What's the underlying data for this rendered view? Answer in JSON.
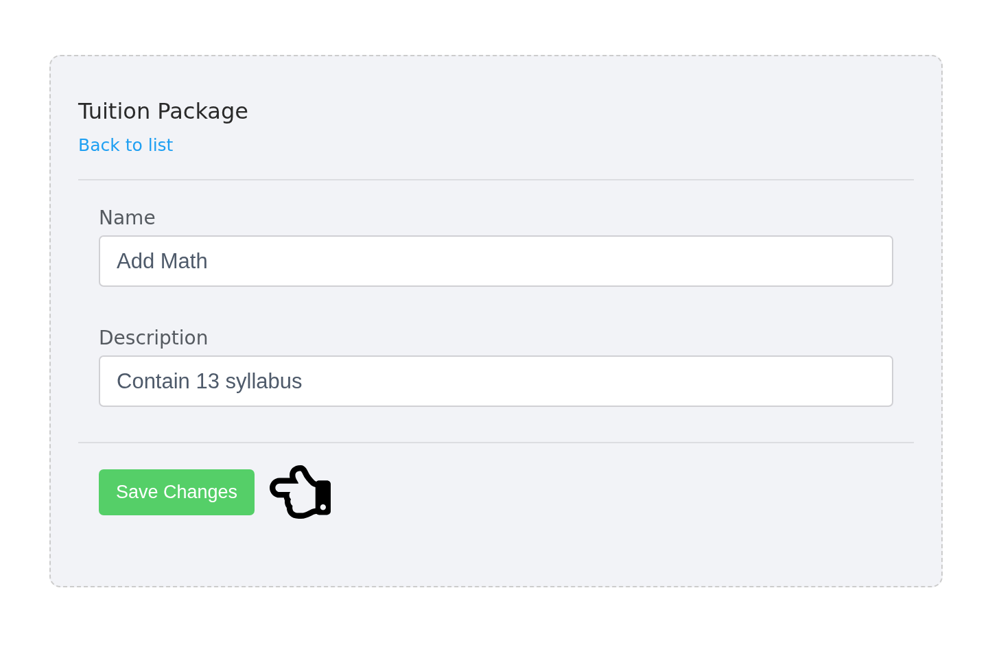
{
  "card": {
    "title": "Tuition Package",
    "back_link": "Back to list",
    "fields": [
      {
        "label": "Name",
        "value": "Add Math"
      },
      {
        "label": "Description",
        "value": "Contain 13 syllabus"
      }
    ],
    "save_button": "Save Changes"
  }
}
